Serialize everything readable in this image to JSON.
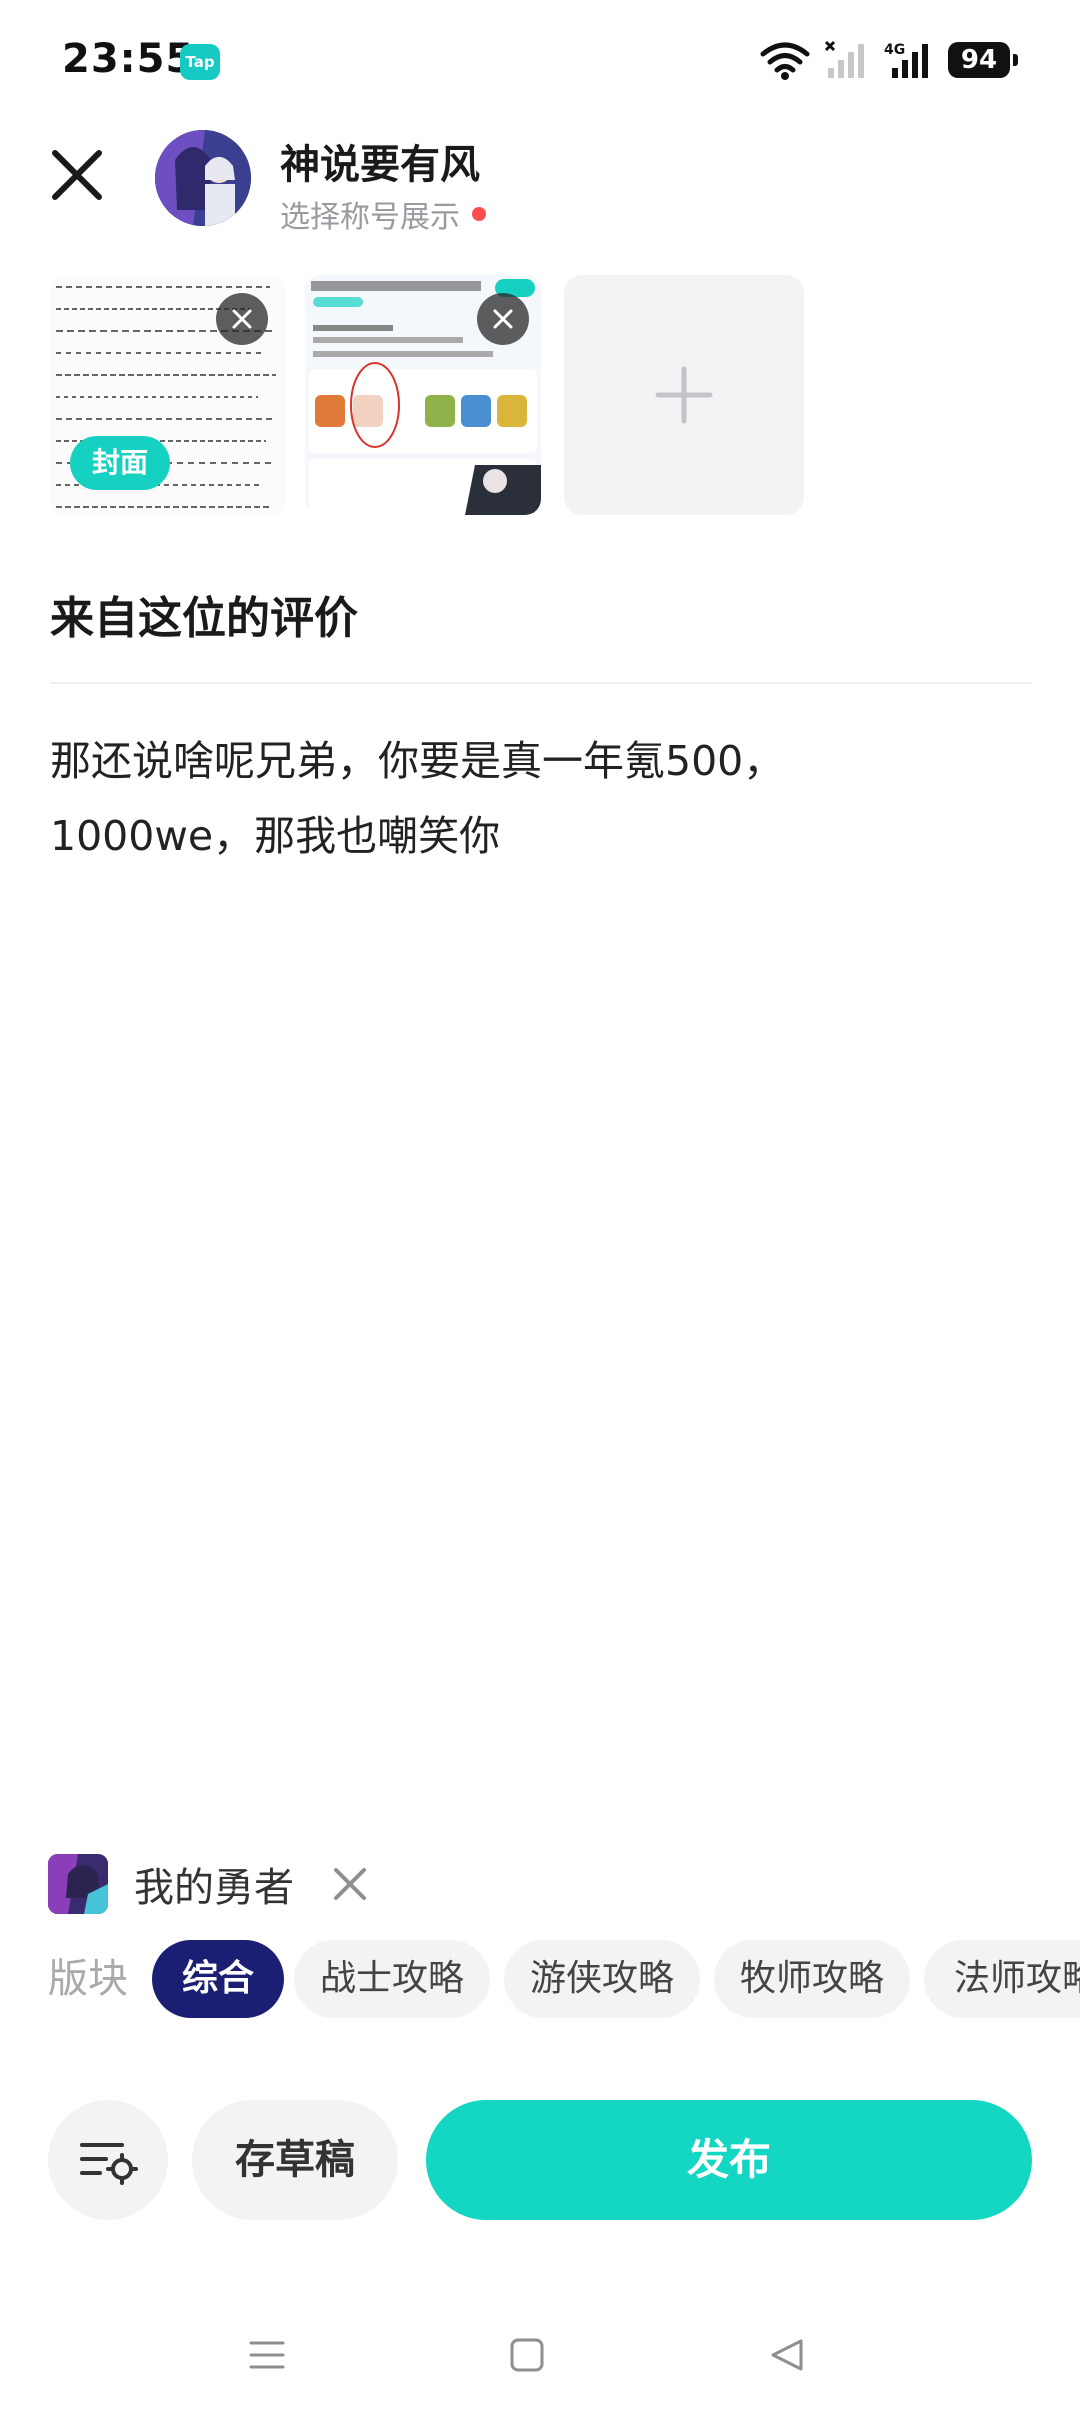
{
  "status_bar": {
    "time": "23:55",
    "app_badge": "Tap",
    "battery": "94",
    "network": "4G"
  },
  "header": {
    "user_name": "神说要有风",
    "title_select": "选择称号展示"
  },
  "images": {
    "cover_label": "封面"
  },
  "review": {
    "section_title": "来自这位的评价",
    "body_line1": "那还说啥呢兄弟，你要是真一年氪500，",
    "body_line2": "1000we，那我也嘲笑你"
  },
  "game": {
    "name": "我的勇者"
  },
  "sections": {
    "label": "版块",
    "chips": [
      {
        "label": "综合",
        "active": true
      },
      {
        "label": "战士攻略",
        "active": false
      },
      {
        "label": "游侠攻略",
        "active": false
      },
      {
        "label": "牧师攻略",
        "active": false
      },
      {
        "label": "法师攻略",
        "active": false
      }
    ]
  },
  "actions": {
    "draft_label": "存草稿",
    "publish_label": "发布"
  },
  "colors": {
    "accent": "#13d6c3",
    "chip_active": "#1b1f74",
    "dot": "#ff4d4f"
  }
}
